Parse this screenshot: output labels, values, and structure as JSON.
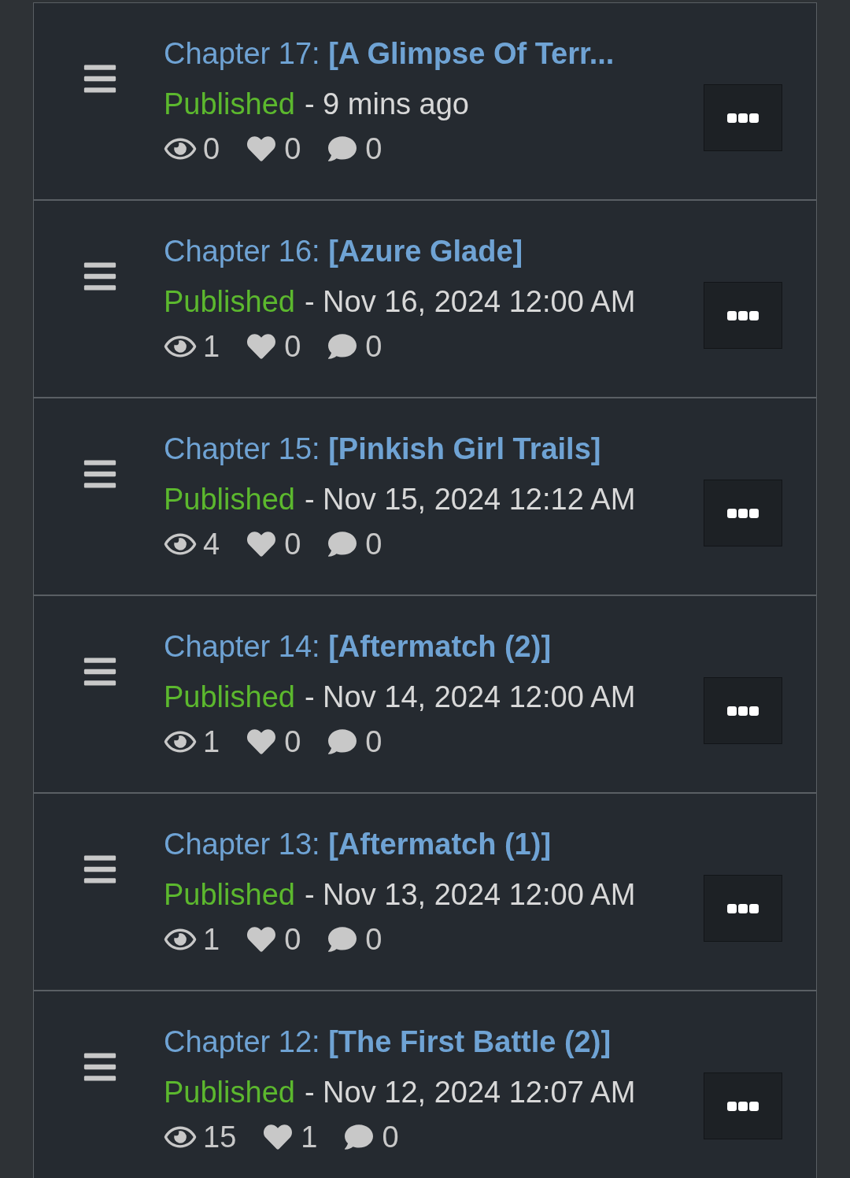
{
  "chapters": [
    {
      "title": "Chapter 17: **[A Glimpse Of Terr...**",
      "status": {
        "label": "Published",
        "kind": "published"
      },
      "time": "- 9 mins ago",
      "views": "0",
      "likes": "0",
      "comments": "0"
    },
    {
      "title": "Chapter 16: **[Azure Glade]**",
      "status": {
        "label": "Published",
        "kind": "published"
      },
      "time": "- Nov 16, 2024 12:00 AM",
      "views": "1",
      "likes": "0",
      "comments": "0"
    },
    {
      "title": "Chapter 15: **[Pinkish Girl Trails]**",
      "status": {
        "label": "Published",
        "kind": "published"
      },
      "time": "- Nov 15, 2024 12:12 AM",
      "views": "4",
      "likes": "0",
      "comments": "0"
    },
    {
      "title": "Chapter 14: **[Aftermatch (2)]**",
      "status": {
        "label": "Published",
        "kind": "published"
      },
      "time": "- Nov 14, 2024 12:00 AM",
      "views": "1",
      "likes": "0",
      "comments": "0"
    },
    {
      "title": "Chapter 13: **[Aftermatch (1)]**",
      "status": {
        "label": "Published",
        "kind": "published"
      },
      "time": "- Nov 13, 2024 12:00 AM",
      "views": "1",
      "likes": "0",
      "comments": "0"
    },
    {
      "title": "Chapter 12: **[The First Battle (2)]**",
      "status": {
        "label": "Published",
        "kind": "published"
      },
      "time": "- Nov 12, 2024 12:07 AM",
      "views": "15",
      "likes": "1",
      "comments": "0"
    }
  ]
}
